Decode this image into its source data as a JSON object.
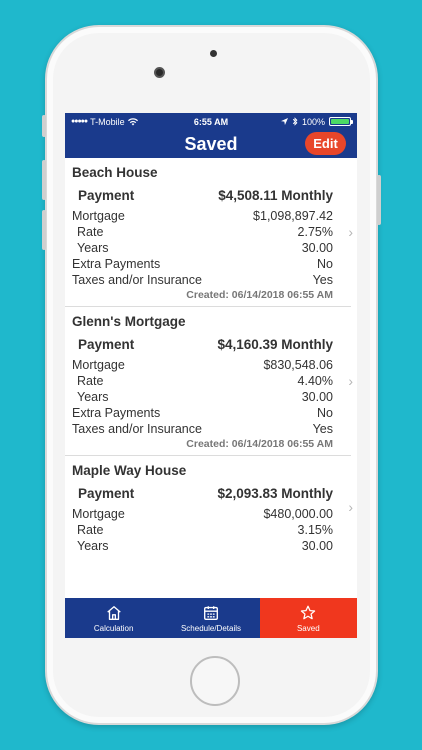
{
  "status_bar": {
    "carrier": "T-Mobile",
    "time": "6:55 AM",
    "battery": "100%"
  },
  "nav": {
    "title": "Saved",
    "edit_label": "Edit"
  },
  "labels": {
    "payment": "Payment",
    "mortgage": "Mortgage",
    "rate": "Rate",
    "years": "Years",
    "extra_payments": "Extra Payments",
    "taxes": "Taxes and/or Insurance"
  },
  "items": [
    {
      "title": "Beach House",
      "payment": "$4,508.11 Monthly",
      "mortgage": "$1,098,897.42",
      "rate": "2.75%",
      "years": "30.00",
      "extra_payments": "No",
      "taxes": "Yes",
      "created": "Created: 06/14/2018 06:55 AM"
    },
    {
      "title": "Glenn's Mortgage",
      "payment": "$4,160.39 Monthly",
      "mortgage": "$830,548.06",
      "rate": "4.40%",
      "years": "30.00",
      "extra_payments": "No",
      "taxes": "Yes",
      "created": "Created: 06/14/2018 06:55 AM"
    },
    {
      "title": "Maple Way House",
      "payment": "$2,093.83 Monthly",
      "mortgage": "$480,000.00",
      "rate": "3.15%",
      "years": "30.00"
    }
  ],
  "tabs": [
    {
      "label": "Calculation",
      "icon": "home-icon",
      "active": false
    },
    {
      "label": "Schedule/Details",
      "icon": "calendar-icon",
      "active": false
    },
    {
      "label": "Saved",
      "icon": "star-icon",
      "active": true
    }
  ],
  "colors": {
    "brand": "#1a3a8c",
    "accent": "#f0371e",
    "background": "#1fb8cc"
  }
}
